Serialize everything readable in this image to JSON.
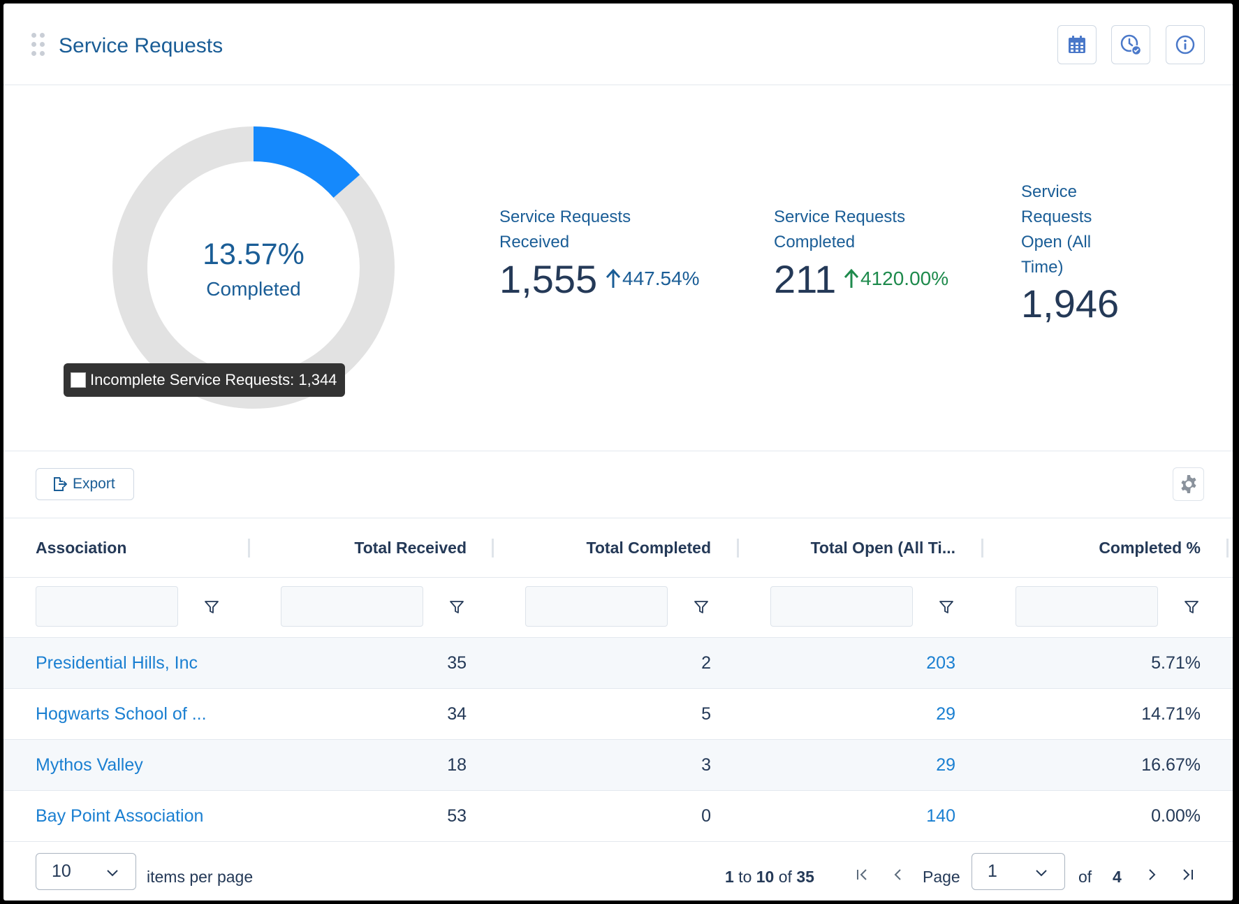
{
  "header": {
    "title": "Service Requests"
  },
  "donut": {
    "percent_label": "13.57%",
    "caption": "Completed",
    "completed_fraction": 0.1357,
    "completed_color": "#1589fc",
    "remainder_color": "#e2e2e2",
    "tooltip": "Incomplete Service Requests: 1,344"
  },
  "stats": {
    "received": {
      "label": "Service Requests Received",
      "value": "1,555",
      "change": "447.54%",
      "change_color": "#1a5d96"
    },
    "completed": {
      "label": "Service Requests Completed",
      "value": "211",
      "change": "4120.00%",
      "change_color": "#1e8a4c"
    },
    "open": {
      "label": "Service Requests Open (All Time)",
      "value": "1,946"
    }
  },
  "toolbar": {
    "export_label": "Export"
  },
  "table": {
    "columns": [
      "Association",
      "Total Received",
      "Total Completed",
      "Total Open (All Ti...",
      "Completed %"
    ],
    "rows": [
      {
        "association": "Presidential Hills, Inc",
        "received": "35",
        "completed": "2",
        "open": "203",
        "pct": "5.71%"
      },
      {
        "association": "Hogwarts School of ...",
        "received": "34",
        "completed": "5",
        "open": "29",
        "pct": "14.71%"
      },
      {
        "association": "Mythos Valley",
        "received": "18",
        "completed": "3",
        "open": "29",
        "pct": "16.67%"
      },
      {
        "association": "Bay Point Association",
        "received": "53",
        "completed": "0",
        "open": "140",
        "pct": "0.00%"
      }
    ]
  },
  "pager": {
    "page_size": "10",
    "items_per_page_label": "items per page",
    "range_start": "1",
    "range_to": "to",
    "range_end": "10",
    "range_of": "of",
    "total": "35",
    "page_label": "Page",
    "current_page": "1",
    "of_label": "of",
    "total_pages": "4"
  },
  "icons": {
    "calendar": "calendar-icon",
    "history": "clock-check-icon",
    "info": "info-icon",
    "export": "export-icon",
    "settings": "gear-icon",
    "filter": "filter-icon"
  }
}
